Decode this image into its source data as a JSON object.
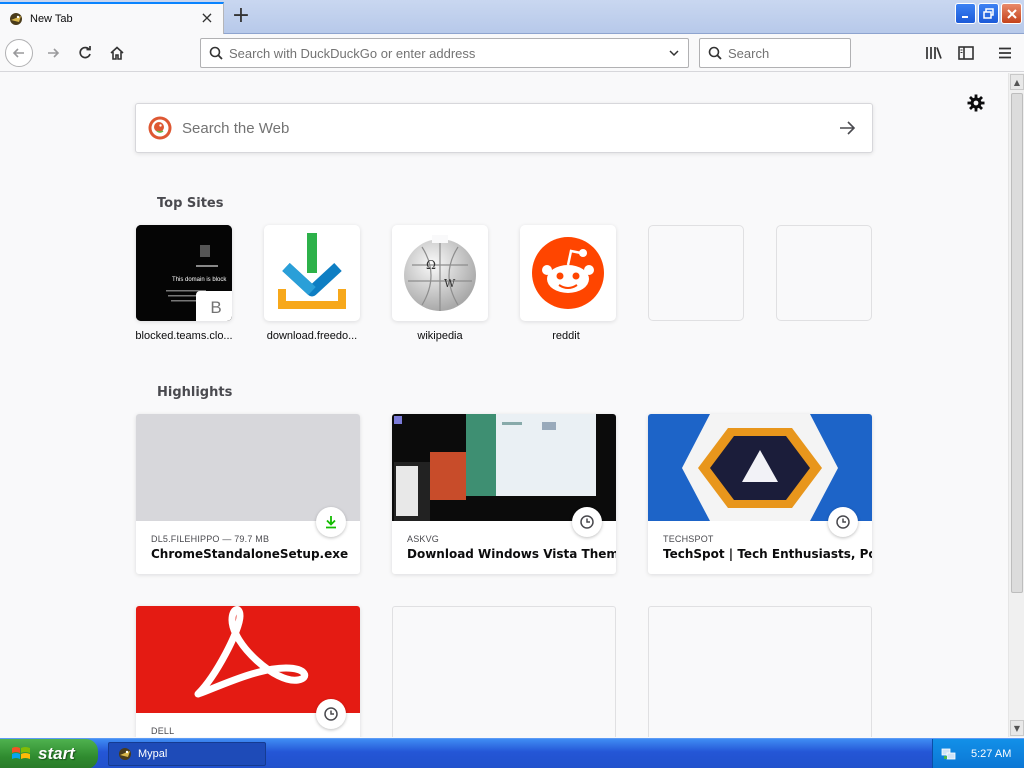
{
  "window": {
    "tab_title": "New Tab",
    "new_tab_label": "+"
  },
  "toolbar": {
    "url_placeholder": "Search with DuckDuckGo or enter address",
    "search_placeholder": "Search"
  },
  "newtab": {
    "web_search_placeholder": "Search the Web",
    "top_sites_title": "Top Sites",
    "highlights_title": "Highlights",
    "top_sites": [
      {
        "label": "blocked.teams.clo...",
        "thumb_text": "This domain is block",
        "badge_letter": "B"
      },
      {
        "label": "download.freedo...",
        "icon": "download-arrow-icon"
      },
      {
        "label": "wikipedia",
        "icon": "wikipedia-globe-icon"
      },
      {
        "label": "reddit",
        "icon": "reddit-alien-icon"
      },
      {
        "label": ""
      },
      {
        "label": ""
      }
    ],
    "highlights": [
      {
        "source": "DL5.FILEHIPPO — 79.7 MB",
        "title": "ChromeStandaloneSetup.exe",
        "badge": "download-icon"
      },
      {
        "source": "ASKVG",
        "title": "Download Windows Vista Them...",
        "badge": "clock-icon"
      },
      {
        "source": "TECHSPOT",
        "title": "TechSpot | Tech Enthusiasts, Po...",
        "badge": "clock-icon"
      },
      {
        "source": "DELL",
        "title": "",
        "badge": "clock-icon"
      }
    ]
  },
  "taskbar": {
    "start_label": "start",
    "task_label": "Mypal",
    "clock": "5:27 AM"
  },
  "colors": {
    "accent": "#0a84ff",
    "reddit": "#ff4500",
    "adobe": "#e41b13",
    "techspot_bg": "#1d64c8",
    "taskbar": "#2456d6",
    "start_green": "#2f8b2f"
  }
}
